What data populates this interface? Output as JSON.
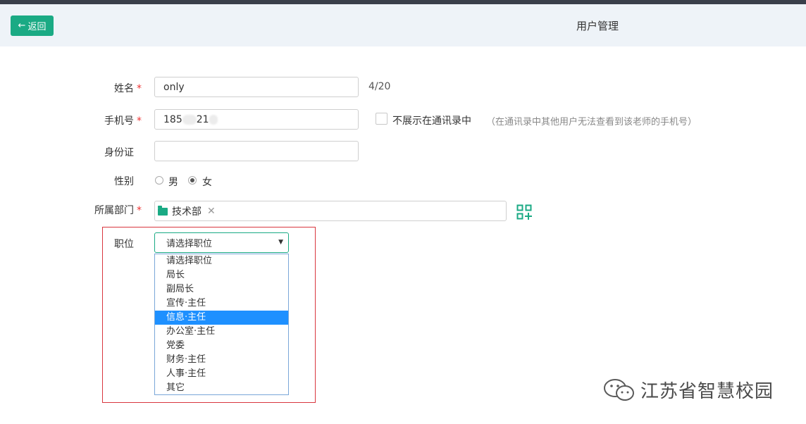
{
  "header": {
    "back_label": "返回",
    "title": "用户管理"
  },
  "form": {
    "name": {
      "label": "姓名",
      "required": "*",
      "value": "only",
      "counter": "4/20"
    },
    "phone": {
      "label": "手机号",
      "required": "*",
      "value_prefix": "185",
      "value_mid": "21",
      "hide_label": "不展示在通讯录中",
      "hint": "（在通讯录中其他用户无法查看到该老师的手机号）"
    },
    "id_card": {
      "label": "身份证",
      "value": ""
    },
    "gender": {
      "label": "性别",
      "options": [
        "男",
        "女"
      ],
      "selected": "女"
    },
    "department": {
      "label": "所属部门",
      "required": "*",
      "tag": "技术部",
      "remove": "✕"
    },
    "position": {
      "label": "职位",
      "selected_value": "请选择职位",
      "options": [
        "请选择职位",
        "局长",
        "副局长",
        "宣传·主任",
        "信息·主任",
        "办公室·主任",
        "党委",
        "财务·主任",
        "人事·主任",
        "其它"
      ],
      "highlighted": "信息·主任"
    }
  },
  "watermark": {
    "text": "江苏省智慧校园"
  },
  "colors": {
    "accent": "#1aaa84",
    "highlight_border": "#d9363e",
    "selected_option": "#1e90ff"
  }
}
